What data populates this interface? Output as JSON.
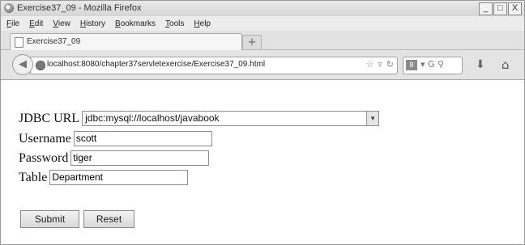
{
  "window": {
    "title": "Exercise37_09 - Mozilla Firefox",
    "controls": [
      "_",
      "□",
      "X"
    ]
  },
  "menu": [
    "File",
    "Edit",
    "View",
    "History",
    "Bookmarks",
    "Tools",
    "Help"
  ],
  "tab": {
    "label": "Exercise37_09",
    "new_tab": "+"
  },
  "nav": {
    "url": "localhost:8080/chapter37servletexercise/Exercise37_09.html",
    "search_engine_label": "8",
    "search_rest": "▾ G ⚲"
  },
  "form": {
    "jdbc_label": "JDBC URL",
    "jdbc_value": "jdbc:mysql://localhost/javabook",
    "username_label": "Username",
    "username_value": "scott",
    "password_label": "Password",
    "password_value": "tiger",
    "table_label": "Table",
    "table_value": "Department",
    "submit_label": "Submit",
    "reset_label": "Reset"
  }
}
